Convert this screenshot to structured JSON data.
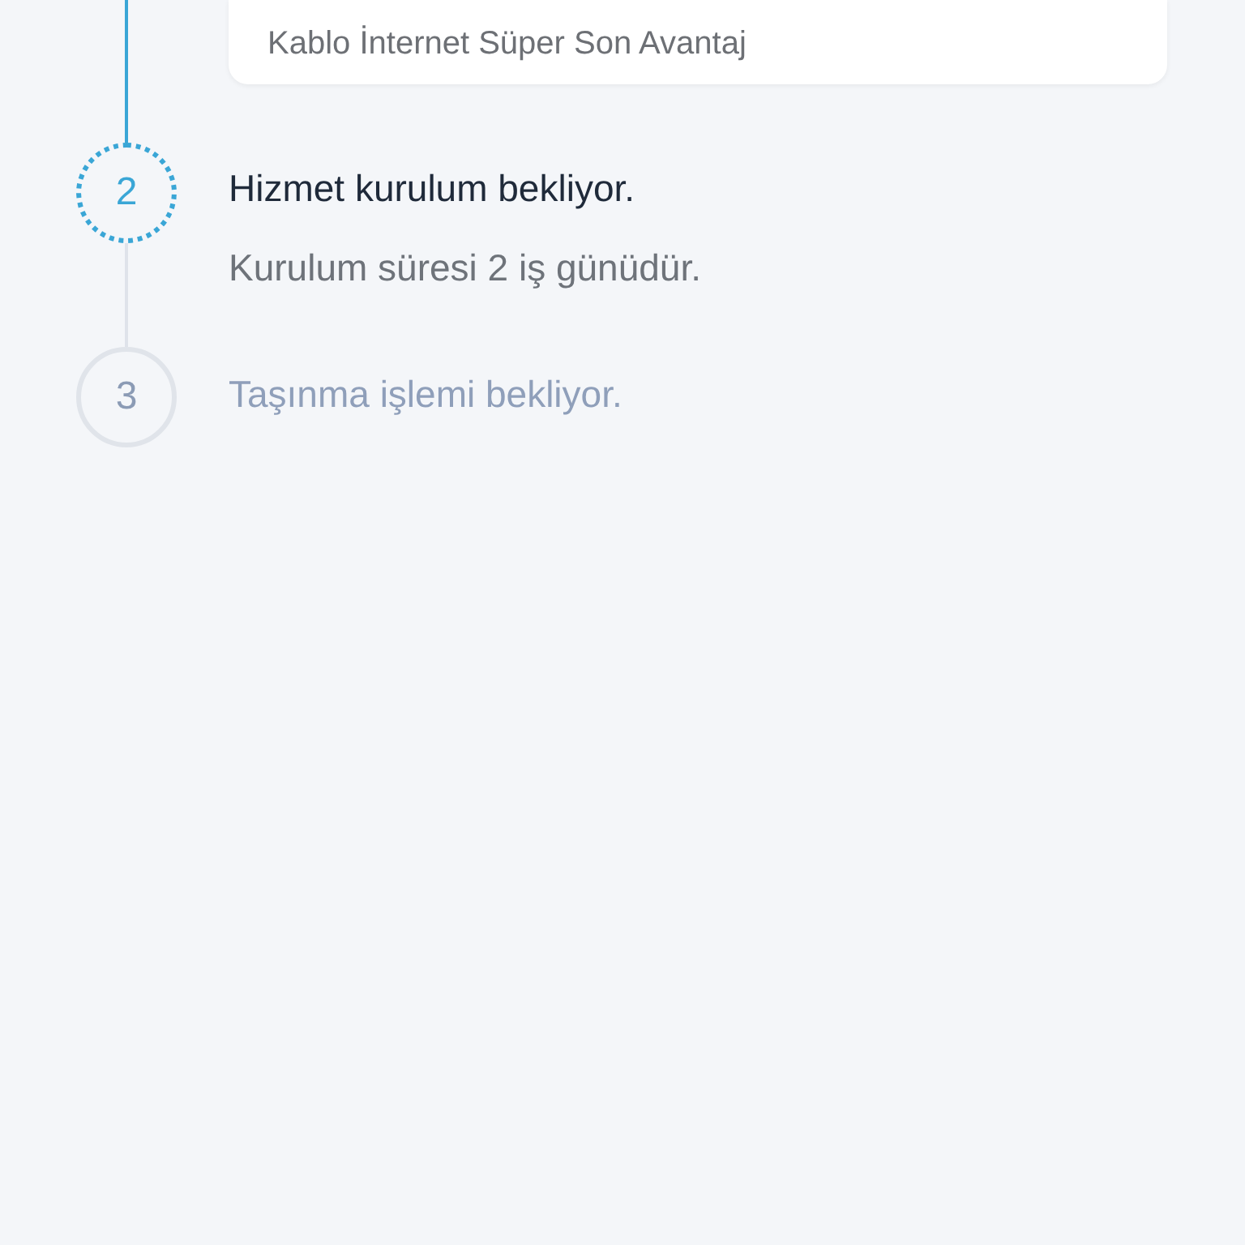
{
  "steps": [
    {
      "kind": "done",
      "detail": "Kablo İnternet Süper Son Avantaj"
    },
    {
      "number": "2",
      "kind": "current",
      "title": "Hizmet kurulum bekliyor.",
      "subtitle": "Kurulum süresi 2 iş günüdür."
    },
    {
      "number": "3",
      "kind": "pending",
      "title": "Taşınma işlemi bekliyor."
    }
  ]
}
